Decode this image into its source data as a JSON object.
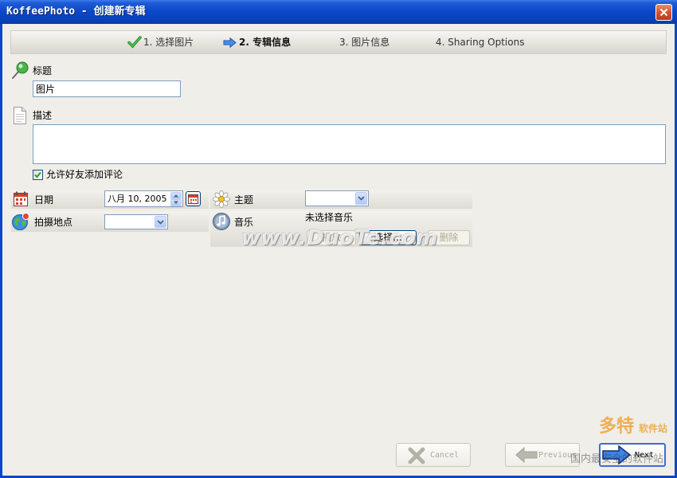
{
  "window": {
    "title": "KoffeePhoto - 创建新专辑",
    "close_icon": "close-icon"
  },
  "wizard_steps": [
    {
      "label": "1. 选择图片",
      "state": "completed",
      "icon": "check-icon"
    },
    {
      "label": "2. 专辑信息",
      "state": "current",
      "icon": "arrow-right-icon"
    },
    {
      "label": "3. 图片信息",
      "state": "pending"
    },
    {
      "label": "4. Sharing Options",
      "state": "pending"
    }
  ],
  "form": {
    "title": {
      "label": "标题",
      "value": "图片",
      "icon": "pin-icon"
    },
    "description": {
      "label": "描述",
      "value": "",
      "icon": "document-icon"
    },
    "allow_comments": {
      "label": "允许好友添加评论",
      "checked": true
    },
    "date": {
      "label": "日期",
      "value": "八月 10, 2005",
      "icon": "calendar-icon",
      "picker_icon": "calendar-button-icon"
    },
    "location": {
      "label": "拍摄地点",
      "value": "",
      "icon": "globe-icon"
    },
    "theme": {
      "label": "主题",
      "value": "",
      "icon": "flower-icon"
    },
    "music": {
      "label": "音乐",
      "status": "未选择音乐",
      "icon": "music-icon",
      "buttons": [
        {
          "label": "播放",
          "enabled": false
        },
        {
          "label": "选择...",
          "enabled": true
        },
        {
          "label": "删除",
          "enabled": false
        }
      ]
    }
  },
  "footer": {
    "cancel": {
      "label": "Cancel",
      "enabled": false,
      "icon": "cancel-x-icon"
    },
    "previous": {
      "label": "Previous",
      "enabled": false,
      "icon": "arrow-left-icon"
    },
    "next": {
      "label": "Next",
      "enabled": true,
      "icon": "arrow-right-icon"
    }
  },
  "watermark": {
    "site": "www.DuoTe.com",
    "brand": "多特",
    "brand_suffix": "软件站",
    "tagline": "国内最安全的软件站"
  },
  "colors": {
    "title_bar": "#0A47C8",
    "window_background": "#EFEEE9",
    "close_button": "#D2502E",
    "step_done": "#4CC04C",
    "step_current_arrow": "#4B8CE8",
    "input_border": "#7F9DB9",
    "disabled_text": "#ACA899",
    "focus_border": "#3C6ED4"
  }
}
